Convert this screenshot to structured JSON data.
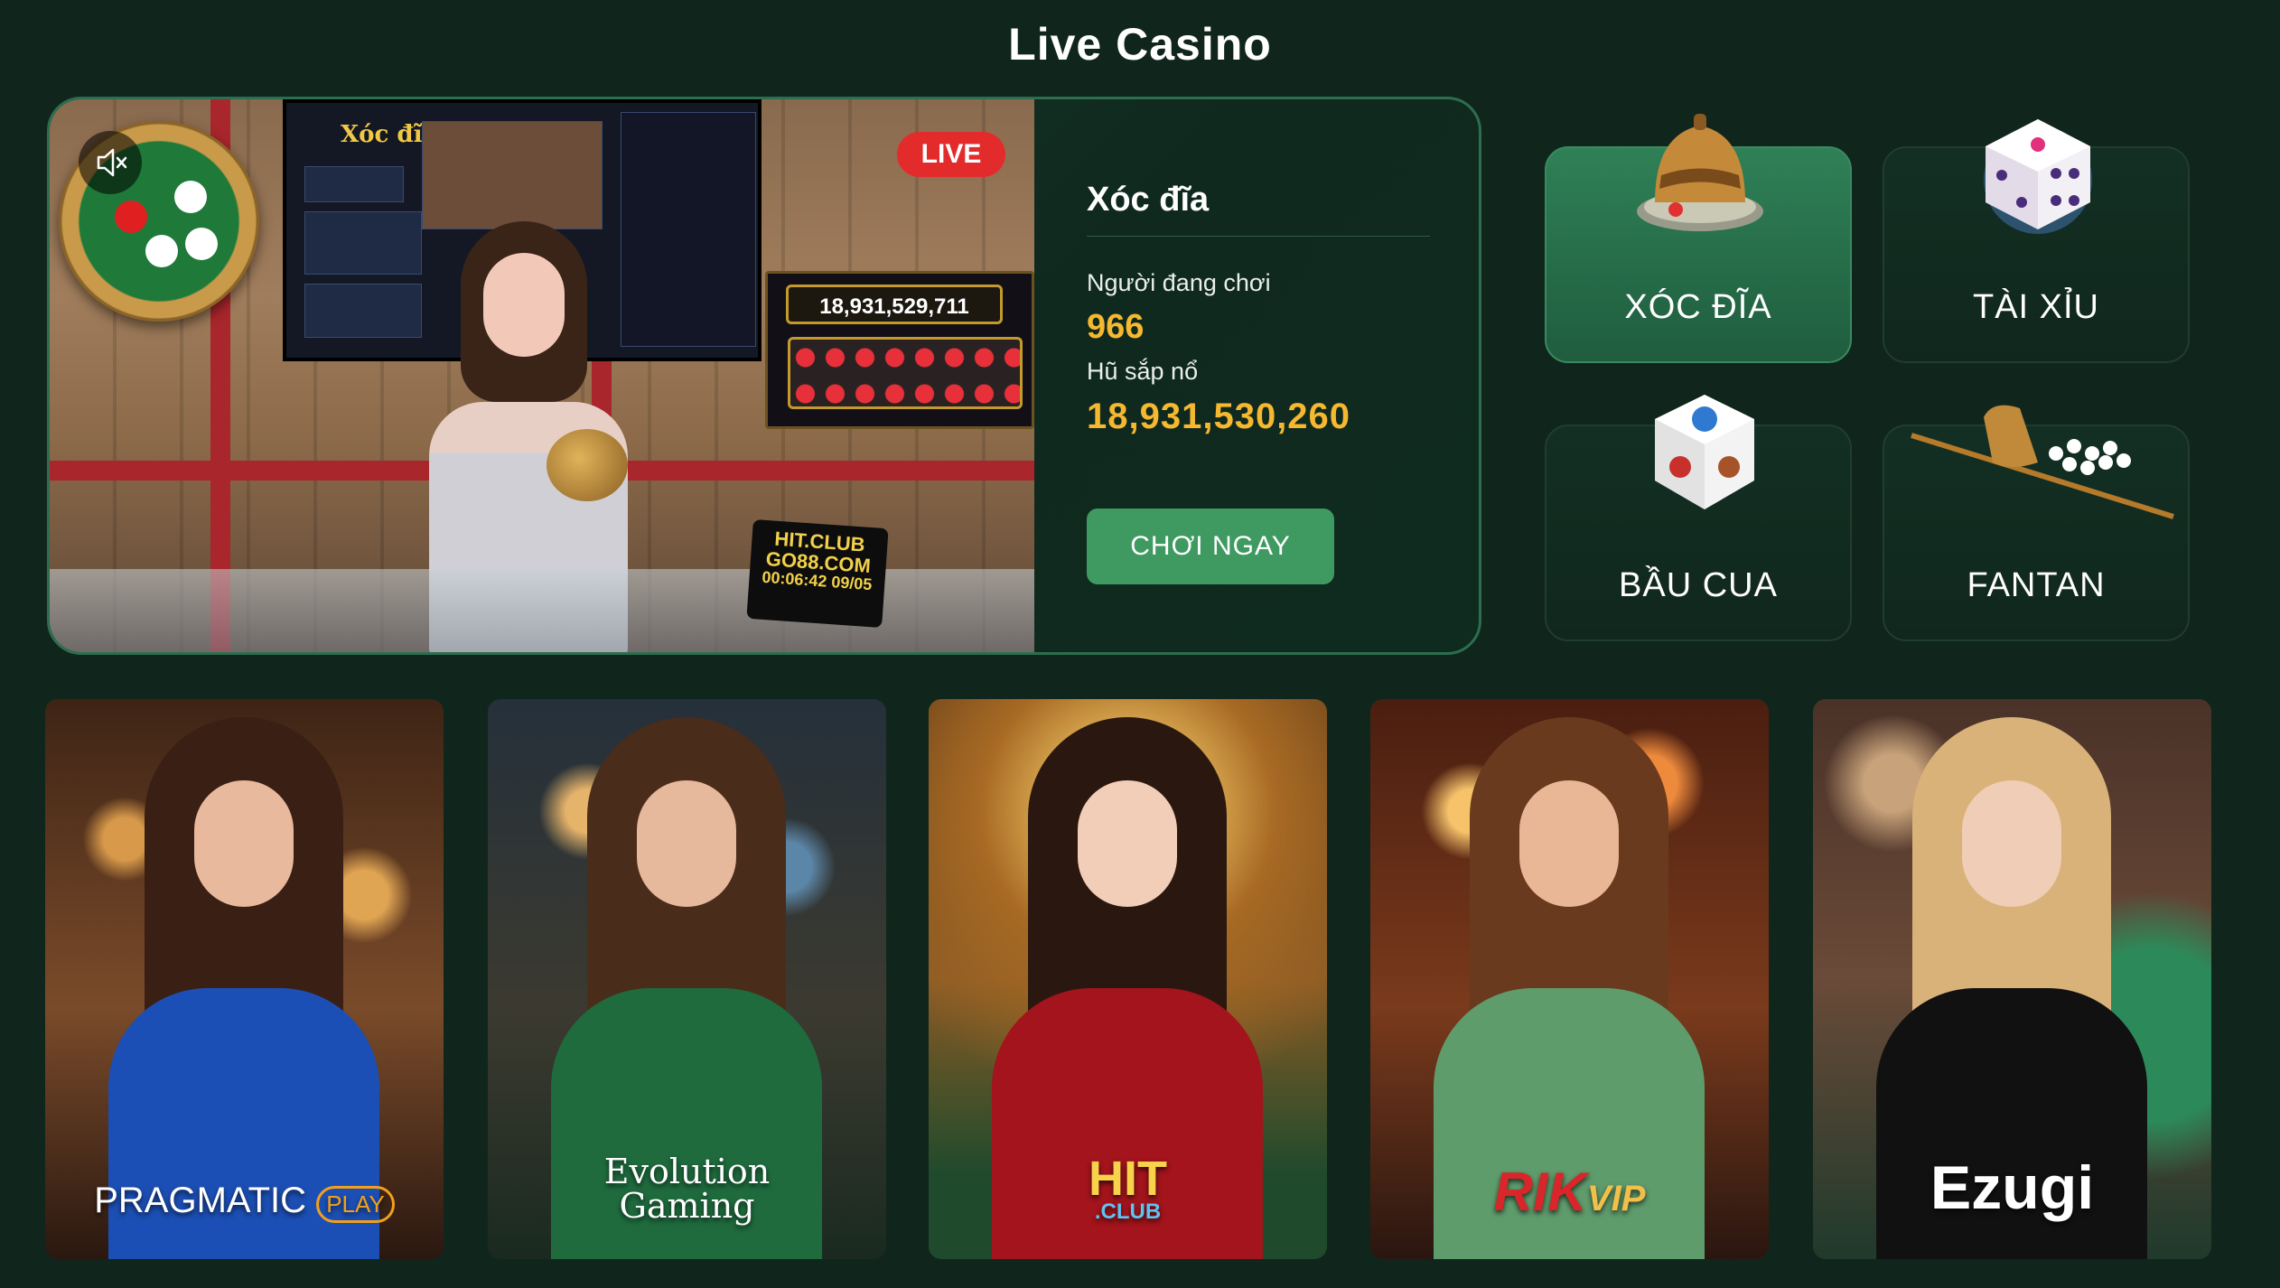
{
  "page_title": "Live Casino",
  "feature": {
    "live_badge": "LIVE",
    "game_title": "Xóc đĩa",
    "players_label": "Người đang chơi",
    "players_value": "966",
    "jackpot_label": "Hũ sắp nổ",
    "jackpot_value": "18,931,530,260",
    "play_button": "CHƠI NGAY",
    "stream": {
      "board_amount": "18,931,529,711",
      "stamp_line1": "HIT.CLUB",
      "stamp_line2": "GO88.COM",
      "stamp_line3": "00:06:42 09/05",
      "monitor_logo": "Xóc đĩa"
    },
    "mute_icon": "speaker-muted-icon"
  },
  "tiles": [
    {
      "label": "XÓC ĐĨA",
      "active": true,
      "icon": "bowl-icon"
    },
    {
      "label": "TÀI XỈU",
      "active": false,
      "icon": "dice-icon"
    },
    {
      "label": "BẦU CUA",
      "active": false,
      "icon": "bau-cua-dice-icon"
    },
    {
      "label": "FANTAN",
      "active": false,
      "icon": "fantan-cup-icon"
    }
  ],
  "providers": [
    {
      "logo": "PRAGMATIC PLAY",
      "logo_main": "PRAGMATIC",
      "logo_badge": "PLAY",
      "dress": "#1c4fb5"
    },
    {
      "logo": "Evolution Gaming",
      "logo_line1": "Evolution",
      "logo_line2": "Gaming",
      "dress": "#1f6b3e"
    },
    {
      "logo": "HIT CLUB",
      "logo_main": "HIT",
      "logo_sub": ".CLUB",
      "dress": "#a3141c"
    },
    {
      "logo": "RIK VIP",
      "logo_main": "RIK",
      "logo_sub": "VIP",
      "dress": "#5f9c6c"
    },
    {
      "logo": "Ezugi",
      "logo_main": "Ezugi",
      "dress": "#111111"
    }
  ],
  "colors": {
    "background": "#10261d",
    "accent_gold": "#f5b82f",
    "button_green": "#3f9a62",
    "live_red": "#e42b2b"
  }
}
